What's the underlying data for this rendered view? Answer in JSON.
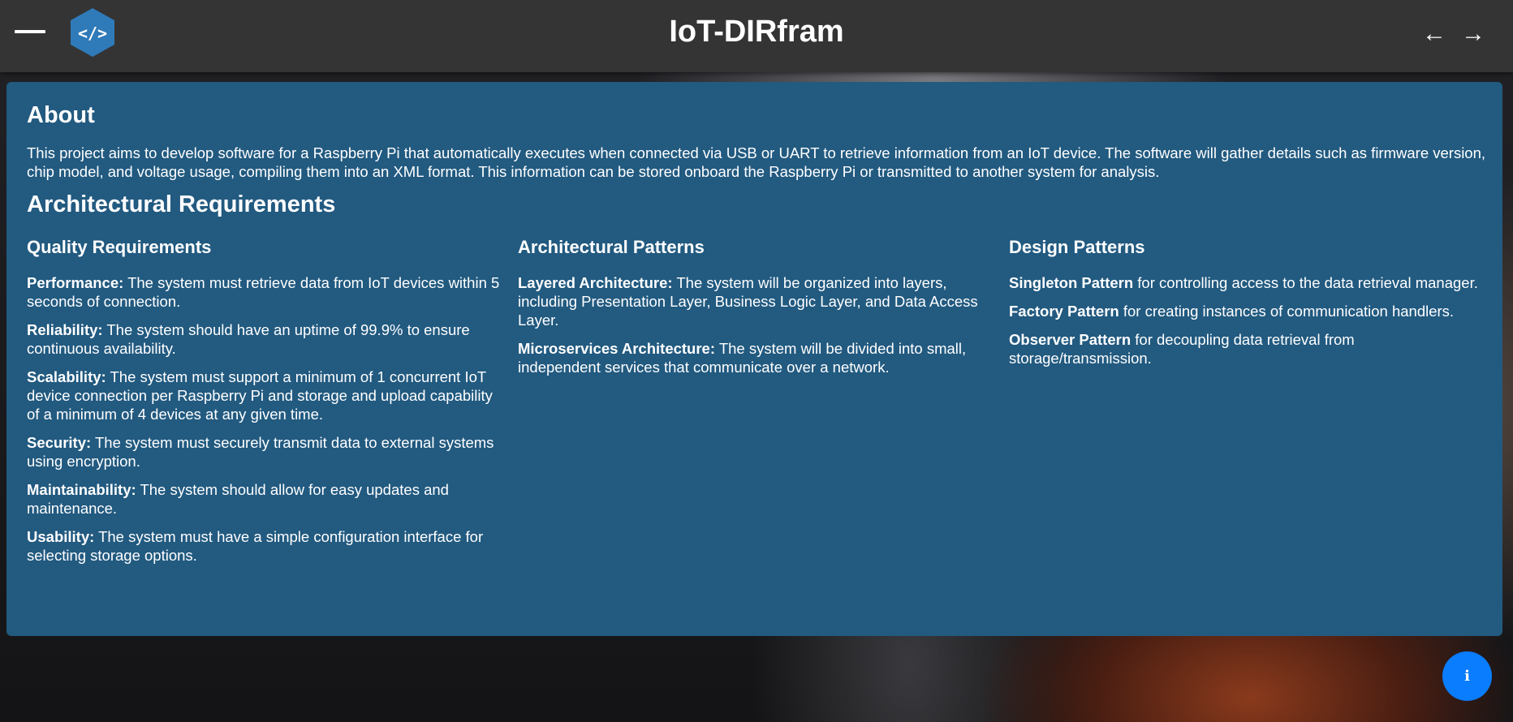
{
  "header": {
    "menu_icon": "hamburger-menu-icon",
    "logo_icon": "code-hexagon-icon",
    "title": "IoT-DIRfram",
    "back_arrow": "←",
    "forward_arrow": "→"
  },
  "about": {
    "title": "About",
    "text": "This project aims to develop software for a Raspberry Pi that automatically executes when connected via USB or UART to retrieve information from an IoT device. The software will gather details such as firmware version, chip model, and voltage usage, compiling them into an XML format. This information can be stored onboard the Raspberry Pi or transmitted to another system for analysis."
  },
  "architecture": {
    "title": "Architectural Requirements",
    "quality": {
      "title": "Quality Requirements",
      "items": [
        {
          "term": "Performance:",
          "text": " The system must retrieve data from IoT devices within 5 seconds of connection."
        },
        {
          "term": "Reliability:",
          "text": " The system should have an uptime of 99.9% to ensure continuous availability."
        },
        {
          "term": "Scalability:",
          "text": " The system must support a minimum of 1 concurrent IoT device connection per Raspberry Pi and storage and upload capability of a minimum of 4 devices at any given time."
        },
        {
          "term": "Security:",
          "text": " The system must securely transmit data to external systems using encryption."
        },
        {
          "term": "Maintainability:",
          "text": " The system should allow for easy updates and maintenance."
        },
        {
          "term": "Usability:",
          "text": " The system must have a simple configuration interface for selecting storage options."
        }
      ]
    },
    "patterns": {
      "title": "Architectural Patterns",
      "items": [
        {
          "term": "Layered Architecture:",
          "text": " The system will be organized into layers, including Presentation Layer, Business Logic Layer, and Data Access Layer."
        },
        {
          "term": "Microservices Architecture:",
          "text": " The system will be divided into small, independent services that communicate over a network."
        }
      ]
    },
    "design": {
      "title": "Design Patterns",
      "items": [
        {
          "term": "Singleton Pattern",
          "text": " for controlling access to the data retrieval manager."
        },
        {
          "term": "Factory Pattern",
          "text": " for creating instances of communication handlers."
        },
        {
          "term": "Observer Pattern",
          "text": " for decoupling data retrieval from storage/transmission."
        }
      ]
    }
  },
  "info_button": {
    "icon": "info-icon",
    "label": "i"
  },
  "colors": {
    "topbar": "#343434",
    "panel": "#225a80",
    "logo": "#2f7ab8",
    "info_button": "#0a7dff"
  }
}
